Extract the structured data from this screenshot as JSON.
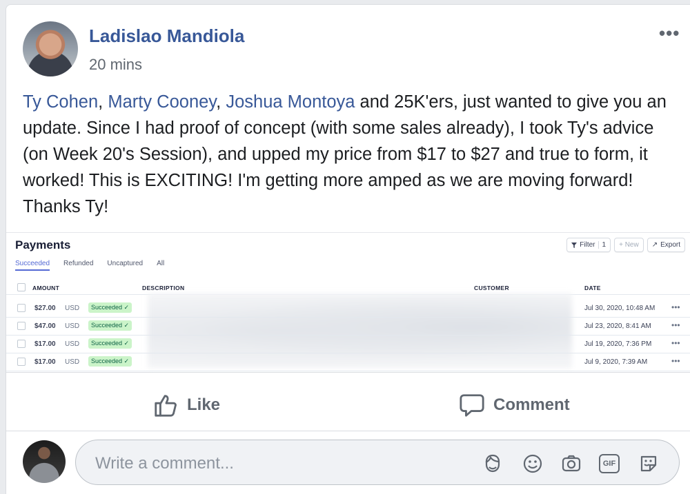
{
  "post": {
    "author": "Ladislao Mandiola",
    "time": "20 mins",
    "more_glyph": "•••",
    "mentions": [
      "Ty Cohen",
      "Marty Cooney",
      "Joshua Montoya"
    ],
    "sep1": ", ",
    "sep2": ", ",
    "body": " and 25K'ers, just wanted to give you an update. Since I had proof of concept (with some sales already), I took Ty's advice (on Week 20's Session), and upped my price from $17 to $27 and true to form, it worked! This is EXCITING! I'm getting more amped as we are moving forward! Thanks Ty!"
  },
  "screenshot": {
    "title": "Payments",
    "tabs": [
      "Succeeded",
      "Refunded",
      "Uncaptured",
      "All"
    ],
    "buttons": {
      "filter": "Filter",
      "filter_count": "1",
      "new": "+ New",
      "export": "Export"
    },
    "columns": {
      "amount": "AMOUNT",
      "description": "DESCRIPTION",
      "customer": "CUSTOMER",
      "date": "DATE"
    },
    "rows": [
      {
        "amount": "$27.00",
        "currency": "USD",
        "status": "Succeeded ✓",
        "date": "Jul 30, 2020, 10:48 AM"
      },
      {
        "amount": "$47.00",
        "currency": "USD",
        "status": "Succeeded ✓",
        "date": "Jul 23, 2020, 8:41 AM"
      },
      {
        "amount": "$17.00",
        "currency": "USD",
        "status": "Succeeded ✓",
        "date": "Jul 19, 2020, 7:36 PM"
      },
      {
        "amount": "$17.00",
        "currency": "USD",
        "status": "Succeeded ✓",
        "date": "Jul 9, 2020, 7:39 AM"
      }
    ],
    "row_menu": "•••"
  },
  "actions": {
    "like": "Like",
    "comment": "Comment"
  },
  "composer": {
    "placeholder": "Write a comment...",
    "gif_label": "GIF",
    "icons": [
      "avatar-sticker-icon",
      "emoji-icon",
      "camera-icon",
      "gif-icon",
      "sticker-icon"
    ]
  },
  "colors": {
    "link": "#385898",
    "muted": "#606770",
    "accent_tab": "#5469d4",
    "badge_bg": "#cbf4c9",
    "badge_fg": "#0e6245"
  }
}
